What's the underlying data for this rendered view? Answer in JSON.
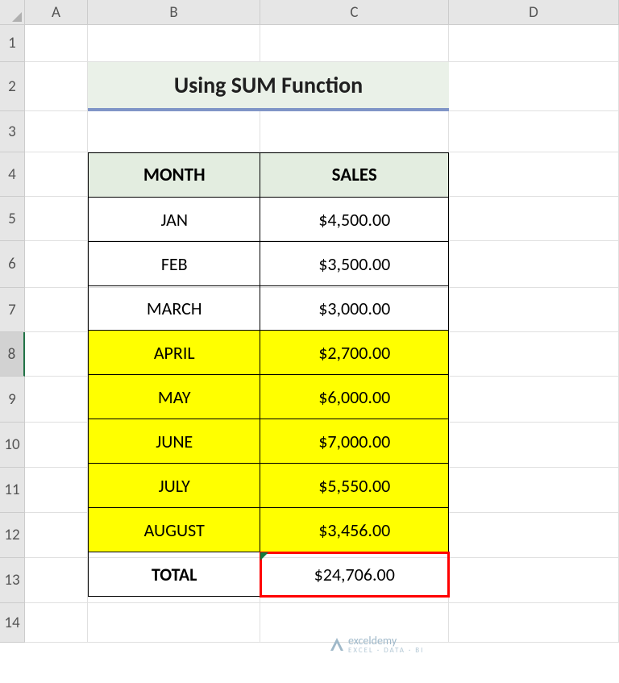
{
  "columns": [
    "A",
    "B",
    "C",
    "D"
  ],
  "rows": [
    "1",
    "2",
    "3",
    "4",
    "5",
    "6",
    "7",
    "8",
    "9",
    "10",
    "11",
    "12",
    "13",
    "14"
  ],
  "title": "Using SUM Function",
  "headers": {
    "month": "MONTH",
    "sales": "SALES"
  },
  "data": [
    {
      "month": "JAN",
      "sales": "$4,500.00",
      "highlight": false
    },
    {
      "month": "FEB",
      "sales": "$3,500.00",
      "highlight": false
    },
    {
      "month": "MARCH",
      "sales": "$3,000.00",
      "highlight": false
    },
    {
      "month": "APRIL",
      "sales": "$2,700.00",
      "highlight": true
    },
    {
      "month": "MAY",
      "sales": "$6,000.00",
      "highlight": true
    },
    {
      "month": "JUNE",
      "sales": "$7,000.00",
      "highlight": true
    },
    {
      "month": "JULY",
      "sales": "$5,550.00",
      "highlight": true
    },
    {
      "month": "AUGUST",
      "sales": "$3,456.00",
      "highlight": true
    }
  ],
  "total": {
    "label": "TOTAL",
    "value": "$24,706.00"
  },
  "selected_row": "8",
  "watermark": {
    "name": "exceldemy",
    "tag": "EXCEL · DATA · BI"
  }
}
